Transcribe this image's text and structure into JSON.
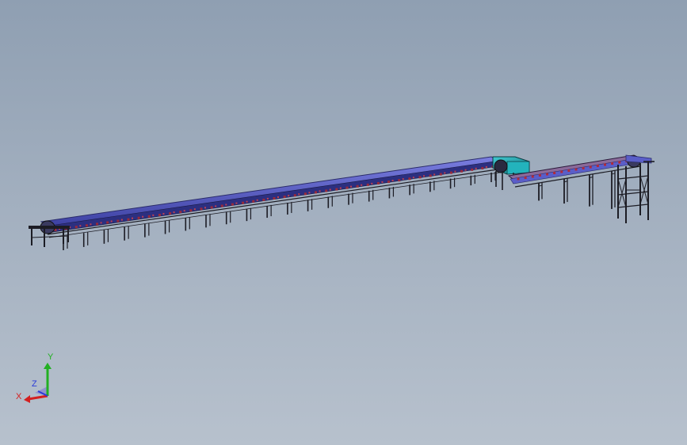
{
  "viewport": {
    "background_top": "#8f9fb2",
    "background_bottom": "#b7c1cd"
  },
  "model": {
    "name_icon": "belt-conveyor-model",
    "colors": {
      "belt": "#5a5ec8",
      "belt_edge": "#2a2c6a",
      "frame": "#1c1c24",
      "roller": "#9a2a3a",
      "hopper": "#1f9fa8"
    }
  },
  "triad": {
    "y_label": "Y",
    "z_label": "Z",
    "x_label": "X",
    "y_color": "#22b022",
    "x_color": "#d42020",
    "z_color": "#2a3ad8"
  }
}
